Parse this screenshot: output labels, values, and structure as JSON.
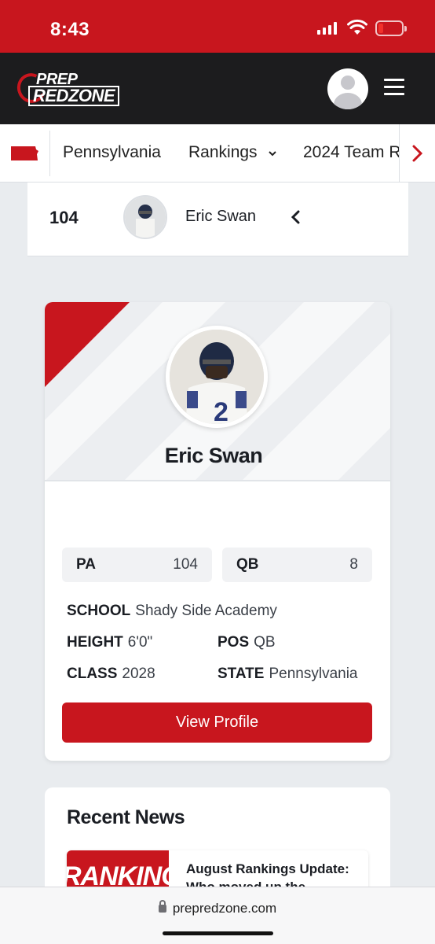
{
  "status_bar": {
    "time": "8:43"
  },
  "header": {
    "logo_line1": "PREP",
    "logo_line2": "REDZONE"
  },
  "nav": {
    "items": [
      "Pennsylvania",
      "Rankings",
      "2024 Team R"
    ]
  },
  "ranking_row": {
    "rank": "104",
    "name": "Eric Swan"
  },
  "player_card": {
    "name": "Eric Swan",
    "stats": [
      {
        "label": "PA",
        "value": "104"
      },
      {
        "label": "QB",
        "value": "8"
      }
    ],
    "school_label": "SCHOOL",
    "school": "Shady Side Academy",
    "height_label": "HEIGHT",
    "height": "6'0\"",
    "pos_label": "POS",
    "pos": "QB",
    "class_label": "CLASS",
    "class": "2028",
    "state_label": "STATE",
    "state": "Pennsylvania",
    "button": "View Profile"
  },
  "news": {
    "title": "Recent News",
    "items": [
      {
        "thumb_text": "RANKINGS",
        "headline": "August Rankings Update: Who moved up the"
      }
    ]
  },
  "browser": {
    "url": "prepredzone.com"
  },
  "colors": {
    "brand_red": "#c8161e",
    "header_dark": "#1c1c1e"
  }
}
